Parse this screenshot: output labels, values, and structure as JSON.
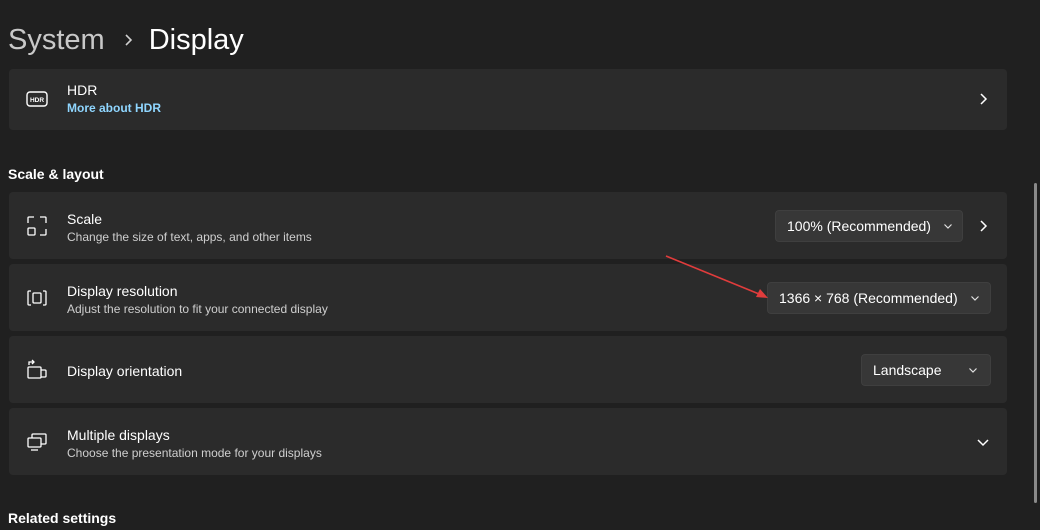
{
  "breadcrumb": {
    "parent": "System",
    "current": "Display",
    "separator_icon": "chevron-right-icon"
  },
  "hdr": {
    "title": "HDR",
    "link": "More about HDR",
    "icon": "hdr-icon"
  },
  "scale_layout": {
    "section_title": "Scale & layout",
    "scale": {
      "title": "Scale",
      "subtitle": "Change the size of text, apps, and other items",
      "value": "100% (Recommended)",
      "icon": "scale-icon"
    },
    "resolution": {
      "title": "Display resolution",
      "subtitle": "Adjust the resolution to fit your connected display",
      "value": "1366 × 768 (Recommended)",
      "icon": "resolution-icon"
    },
    "orientation": {
      "title": "Display orientation",
      "value": "Landscape",
      "icon": "orientation-icon"
    },
    "multiple": {
      "title": "Multiple displays",
      "subtitle": "Choose the presentation mode for your displays",
      "icon": "multiple-displays-icon"
    }
  },
  "related": {
    "section_title": "Related settings"
  },
  "colors": {
    "background": "#202020",
    "card": "#2b2b2b",
    "accent_link": "#8fd6ff",
    "annotation_arrow": "#e03c3c"
  }
}
